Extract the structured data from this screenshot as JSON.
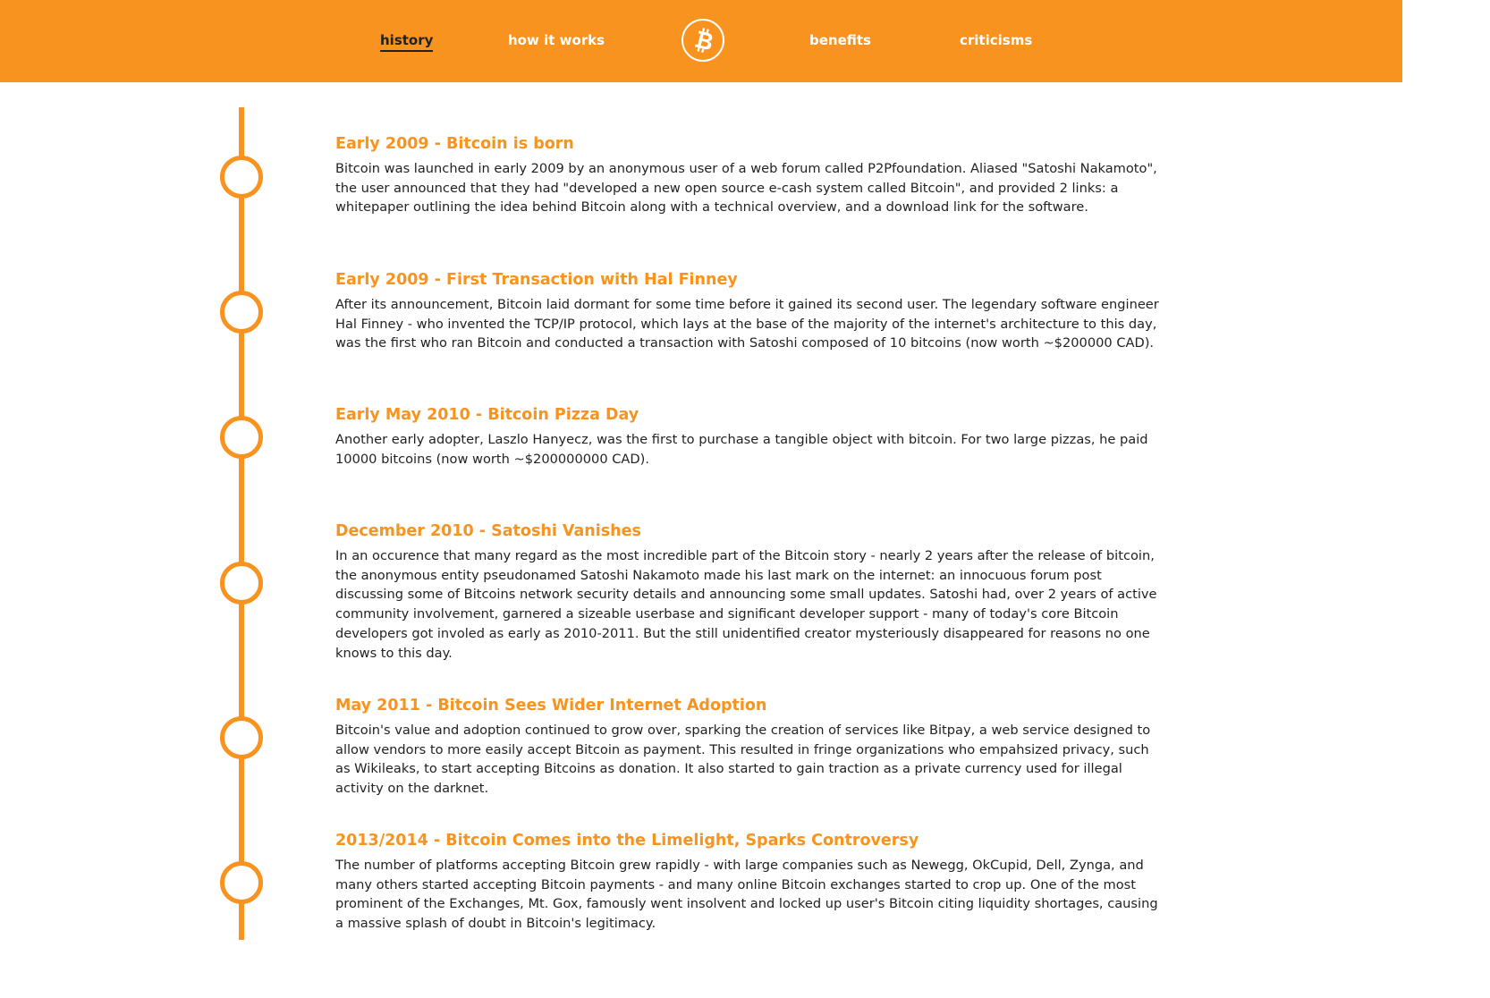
{
  "nav": {
    "history": "history",
    "how_it_works": "how it works",
    "benefits": "benefits",
    "criticisms": "criticisms",
    "logo_icon": "bitcoin-logo-icon"
  },
  "colors": {
    "accent": "#f7931e",
    "text": "#222222",
    "background": "#ffffff"
  },
  "timeline": {
    "entries": [
      {
        "title": "Early 2009 - Bitcoin is born",
        "body": "Bitcoin was launched in early 2009 by an anonymous user of a web forum called P2Pfoundation. Aliased \"Satoshi Nakamoto\", the user announced that they had \"developed a new open source e-cash system called Bitcoin\", and provided 2 links: a whitepaper outlining the idea behind Bitcoin along with a technical overview, and a download link for the software."
      },
      {
        "title": "Early 2009 - First Transaction with Hal Finney",
        "body": "After its announcement, Bitcoin laid dormant for some time before it gained its second user. The legendary software engineer Hal Finney - who invented the TCP/IP protocol, which lays at the base of the majority of the internet's architecture to this day, was the first who ran Bitcoin and conducted a transaction with Satoshi composed of 10 bitcoins (now worth ~$200000 CAD)."
      },
      {
        "title": "Early May 2010 - Bitcoin Pizza Day",
        "body": "Another early adopter, Laszlo Hanyecz, was the first to purchase a tangible object with bitcoin. For two large pizzas, he paid 10000 bitcoins (now worth ~$200000000 CAD)."
      },
      {
        "title": "December 2010 - Satoshi Vanishes",
        "body": "In an occurence that many regard as the most incredible part of the Bitcoin story - nearly 2 years after the release of bitcoin, the anonymous entity pseudonamed Satoshi Nakamoto made his last mark on the internet: an innocuous forum post discussing some of Bitcoins network security details and announcing some small updates. Satoshi had, over 2 years of active community involvement, garnered a sizeable userbase and significant developer support - many of today's core Bitcoin developers got involed as early as 2010-2011. But the still unidentified creator mysteriously disappeared for reasons no one knows to this day."
      },
      {
        "title": "May 2011 - Bitcoin Sees Wider Internet Adoption",
        "body": "Bitcoin's value and adoption continued to grow over, sparking the creation of services like Bitpay, a web service designed to allow vendors to more easily accept Bitcoin as payment. This resulted in fringe organizations who empahsized privacy, such as Wikileaks, to start accepting Bitcoins as donation. It also started to gain traction as a private currency used for illegal activity on the darknet."
      },
      {
        "title": "2013/2014 - Bitcoin Comes into the Limelight, Sparks Controversy",
        "body": "The number of platforms accepting Bitcoin grew rapidly - with large companies such as Newegg, OkCupid, Dell, Zynga, and many others started accepting Bitcoin payments - and many online Bitcoin exchanges started to crop up. One of the most prominent of the Exchanges, Mt. Gox, famously went insolvent and locked up user's Bitcoin citing liquidity shortages, causing a massive splash of doubt in Bitcoin's legitimacy."
      }
    ]
  }
}
